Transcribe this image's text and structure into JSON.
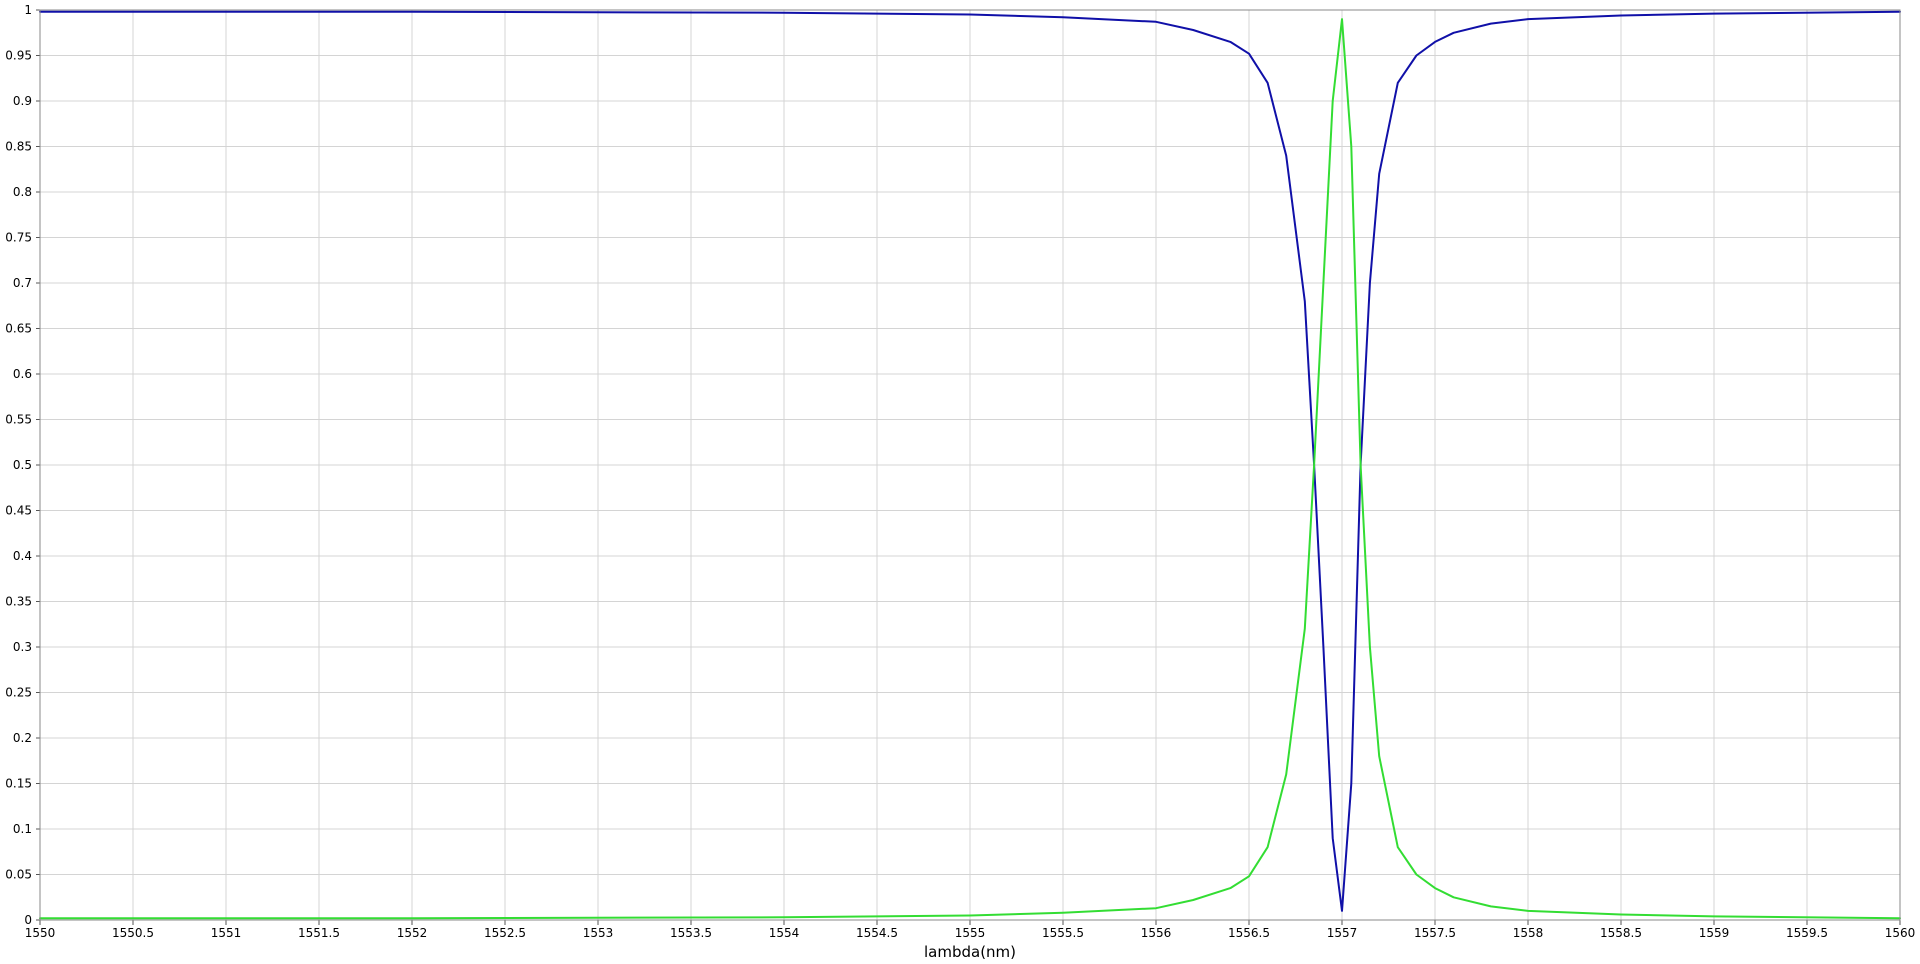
{
  "chart_data": {
    "type": "line",
    "title": "",
    "xlabel": "lambda(nm)",
    "ylabel": "",
    "xlim": [
      1550,
      1560
    ],
    "ylim": [
      0,
      1
    ],
    "grid": true,
    "legend": "none",
    "x_ticks": [
      "1550",
      "1550.5",
      "1551",
      "1551.5",
      "1552",
      "1552.5",
      "1553",
      "1553.5",
      "1554",
      "1554.5",
      "1555",
      "1555.5",
      "1556",
      "1556.5",
      "1557",
      "1557.5",
      "1558",
      "1558.5",
      "1559",
      "1559.5",
      "1560"
    ],
    "y_ticks": [
      "0",
      "0.05",
      "0.1",
      "0.15",
      "0.2",
      "0.25",
      "0.3",
      "0.35",
      "0.4",
      "0.45",
      "0.5",
      "0.55",
      "0.6",
      "0.65",
      "0.7",
      "0.75",
      "0.8",
      "0.85",
      "0.9",
      "0.95",
      "1"
    ],
    "series": [
      {
        "color": "#1010a8",
        "x": [
          1550,
          1552,
          1554,
          1555,
          1555.5,
          1556,
          1556.2,
          1556.4,
          1556.5,
          1556.6,
          1556.7,
          1556.8,
          1556.85,
          1556.9,
          1556.95,
          1557,
          1557.05,
          1557.1,
          1557.15,
          1557.2,
          1557.3,
          1557.4,
          1557.5,
          1557.6,
          1557.8,
          1558,
          1558.5,
          1559,
          1560
        ],
        "y": [
          0.998,
          0.998,
          0.997,
          0.995,
          0.992,
          0.987,
          0.978,
          0.965,
          0.952,
          0.92,
          0.84,
          0.68,
          0.5,
          0.3,
          0.09,
          0.01,
          0.15,
          0.5,
          0.7,
          0.82,
          0.92,
          0.95,
          0.965,
          0.975,
          0.985,
          0.99,
          0.994,
          0.996,
          0.998
        ]
      },
      {
        "color": "#33dd33",
        "x": [
          1550,
          1552,
          1554,
          1555,
          1555.5,
          1556,
          1556.2,
          1556.4,
          1556.5,
          1556.6,
          1556.7,
          1556.8,
          1556.85,
          1556.9,
          1556.95,
          1557,
          1557.05,
          1557.1,
          1557.15,
          1557.2,
          1557.3,
          1557.4,
          1557.5,
          1557.6,
          1557.8,
          1558,
          1558.5,
          1559,
          1560
        ],
        "y": [
          0.002,
          0.002,
          0.003,
          0.005,
          0.008,
          0.013,
          0.022,
          0.035,
          0.048,
          0.08,
          0.16,
          0.32,
          0.5,
          0.7,
          0.9,
          0.99,
          0.85,
          0.5,
          0.3,
          0.18,
          0.08,
          0.05,
          0.035,
          0.025,
          0.015,
          0.01,
          0.006,
          0.004,
          0.002
        ]
      }
    ]
  }
}
